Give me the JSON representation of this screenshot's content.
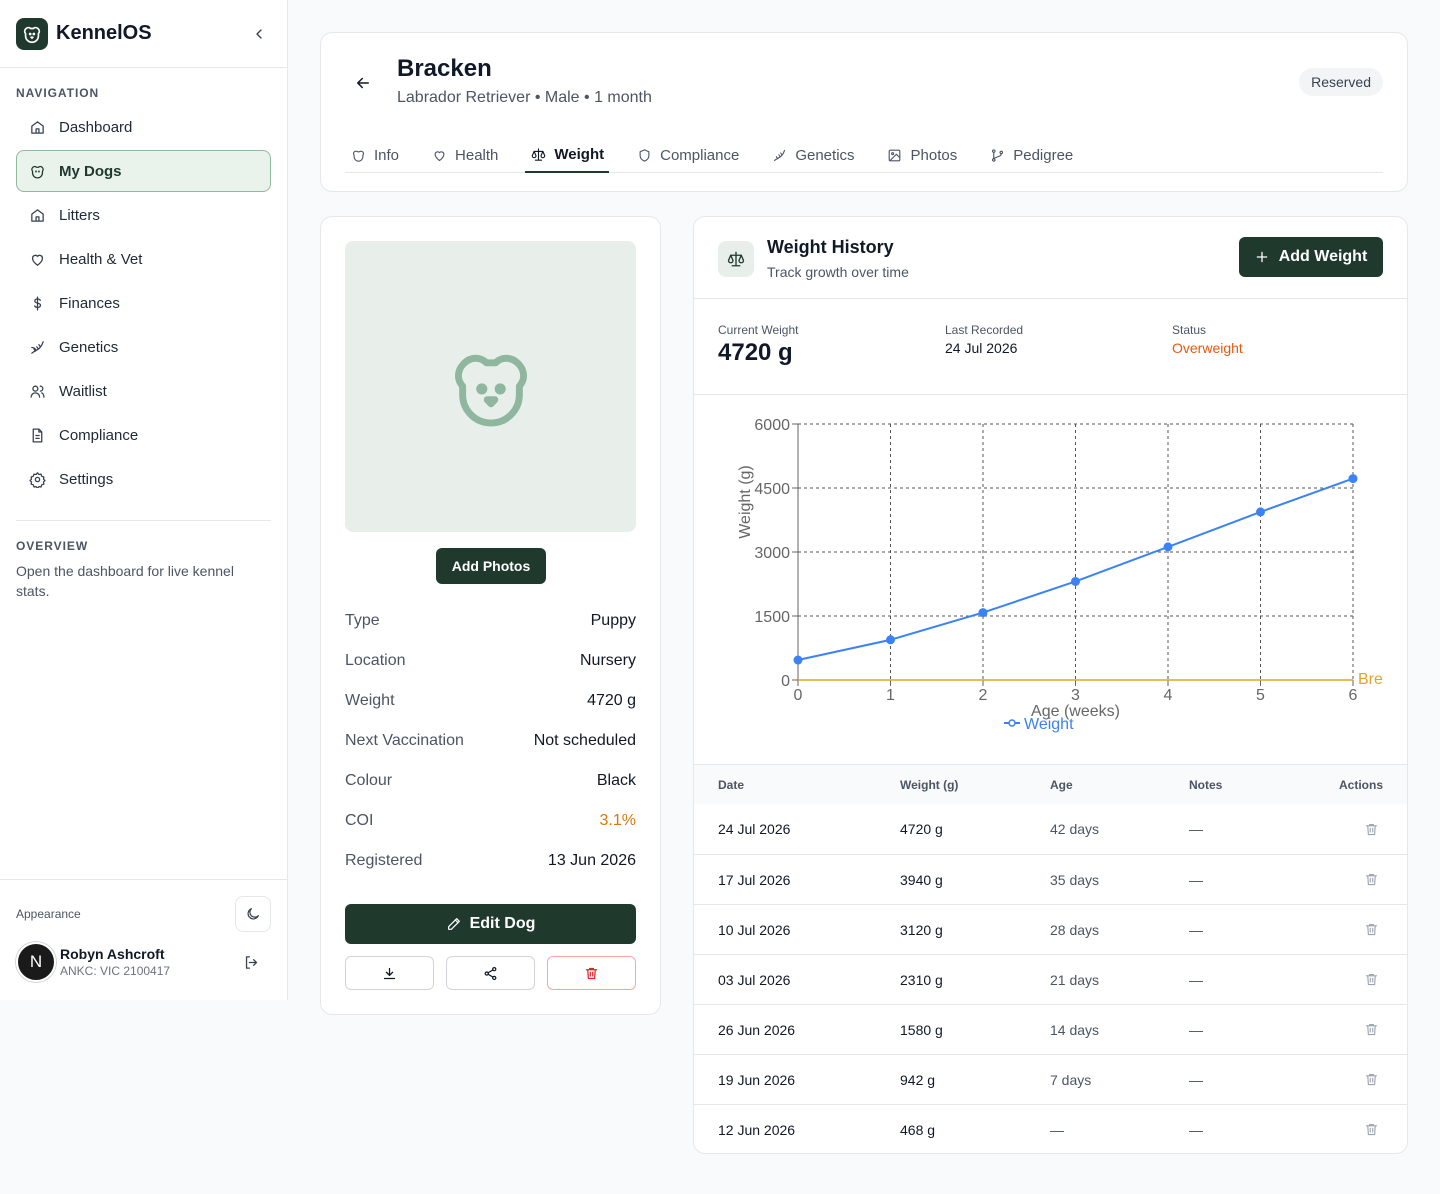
{
  "app": {
    "name": "KennelOS"
  },
  "sidebar": {
    "nav_heading": "NAVIGATION",
    "items": [
      {
        "label": "Dashboard",
        "icon": "home-icon"
      },
      {
        "label": "My Dogs",
        "icon": "dog-icon",
        "active": true
      },
      {
        "label": "Litters",
        "icon": "home-icon"
      },
      {
        "label": "Health & Vet",
        "icon": "heart-icon"
      },
      {
        "label": "Finances",
        "icon": "dollar-icon"
      },
      {
        "label": "Genetics",
        "icon": "dna-icon"
      },
      {
        "label": "Waitlist",
        "icon": "users-icon"
      },
      {
        "label": "Compliance",
        "icon": "document-icon"
      },
      {
        "label": "Settings",
        "icon": "gear-icon"
      }
    ],
    "overview_heading": "OVERVIEW",
    "overview_text": "Open the dashboard for live kennel stats.",
    "appearance_label": "Appearance",
    "user": {
      "initial": "N",
      "name": "Robyn Ashcroft",
      "registration": "ANKC: VIC 2100417"
    }
  },
  "dog": {
    "name": "Bracken",
    "subtitle": "Labrador Retriever • Male • 1 month",
    "status": "Reserved"
  },
  "tabs": [
    {
      "label": "Info",
      "icon": "dog-icon"
    },
    {
      "label": "Health",
      "icon": "heart-icon"
    },
    {
      "label": "Weight",
      "icon": "scale-icon",
      "active": true
    },
    {
      "label": "Compliance",
      "icon": "shield-icon"
    },
    {
      "label": "Genetics",
      "icon": "dna-icon"
    },
    {
      "label": "Photos",
      "icon": "image-icon"
    },
    {
      "label": "Pedigree",
      "icon": "branch-icon"
    }
  ],
  "profile": {
    "add_photos_label": "Add Photos",
    "fields": [
      {
        "label": "Type",
        "value": "Puppy"
      },
      {
        "label": "Location",
        "value": "Nursery"
      },
      {
        "label": "Weight",
        "value": "4720 g"
      },
      {
        "label": "Next Vaccination",
        "value": "Not scheduled"
      },
      {
        "label": "Colour",
        "value": "Black"
      },
      {
        "label": "COI",
        "value": "3.1%",
        "highlight": "#d97706"
      },
      {
        "label": "Registered",
        "value": "13 Jun 2026"
      }
    ],
    "edit_label": "Edit Dog"
  },
  "weight": {
    "title": "Weight History",
    "subtitle": "Track growth over time",
    "add_label": "Add Weight",
    "current_label": "Current Weight",
    "current_value": "4720 g",
    "last_label": "Last Recorded",
    "last_value": "24 Jul 2026",
    "status_label": "Status",
    "status_value": "Overweight",
    "table": {
      "columns": [
        "Date",
        "Weight (g)",
        "Age",
        "Notes",
        "Actions"
      ],
      "rows": [
        {
          "date": "24 Jul 2026",
          "weight": "4720 g",
          "age": "42 days",
          "notes": "—"
        },
        {
          "date": "17 Jul 2026",
          "weight": "3940 g",
          "age": "35 days",
          "notes": "—"
        },
        {
          "date": "10 Jul 2026",
          "weight": "3120 g",
          "age": "28 days",
          "notes": "—"
        },
        {
          "date": "03 Jul 2026",
          "weight": "2310 g",
          "age": "21 days",
          "notes": "—"
        },
        {
          "date": "26 Jun 2026",
          "weight": "1580 g",
          "age": "14 days",
          "notes": "—"
        },
        {
          "date": "19 Jun 2026",
          "weight": "942 g",
          "age": "7 days",
          "notes": "—"
        },
        {
          "date": "12 Jun 2026",
          "weight": "468 g",
          "age": "—",
          "notes": "—"
        }
      ]
    }
  },
  "chart_data": {
    "type": "line",
    "xlabel": "Age (weeks)",
    "ylabel": "Weight (g)",
    "xlim": [
      0,
      6
    ],
    "ylim": [
      0,
      6000
    ],
    "x_ticks": [
      0,
      1,
      2,
      3,
      4,
      5,
      6
    ],
    "y_ticks": [
      0,
      1500,
      3000,
      4500,
      6000
    ],
    "grid": true,
    "series": [
      {
        "name": "Weight",
        "color": "#3b82f6",
        "x": [
          0,
          1,
          2,
          3,
          4,
          5,
          6
        ],
        "y": [
          468,
          942,
          1580,
          2310,
          3120,
          3940,
          4720
        ]
      },
      {
        "name": "Bre",
        "color": "#e0a526",
        "x": [
          0,
          6
        ],
        "y": [
          0,
          0
        ]
      }
    ],
    "legend": "bottom"
  }
}
